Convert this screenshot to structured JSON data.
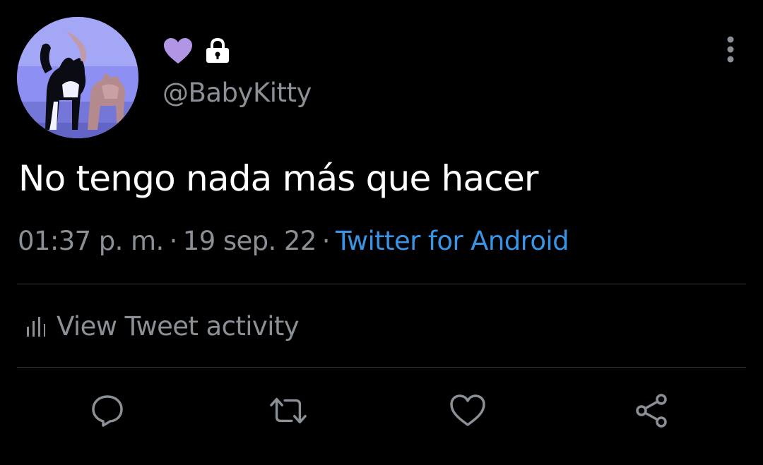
{
  "user": {
    "handle": "@BabyKitty",
    "name_badges": [
      "purple-heart-icon",
      "lock-icon"
    ],
    "avatar": "cat-photo-avatar"
  },
  "tweet": {
    "text": "No tengo nada más que hacer",
    "time": "01:37 p. m.",
    "date": "19 sep. 22",
    "separator": "·",
    "source": "Twitter for Android"
  },
  "activity": {
    "label": "View Tweet activity",
    "icon": "bar-chart-icon"
  },
  "actions": [
    {
      "name": "reply",
      "icon": "reply-bubble-icon"
    },
    {
      "name": "retweet",
      "icon": "retweet-icon"
    },
    {
      "name": "like",
      "icon": "heart-outline-icon"
    },
    {
      "name": "share",
      "icon": "share-icon"
    }
  ],
  "colors": {
    "background": "#000000",
    "text_primary": "#ffffff",
    "text_secondary": "#8b9097",
    "link": "#3a94e6",
    "heart_badge": "#b296e6",
    "divider": "#2f3336"
  }
}
